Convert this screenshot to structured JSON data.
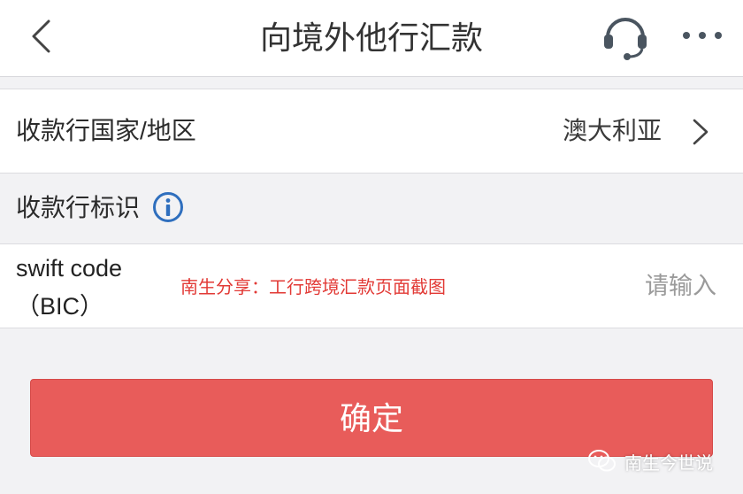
{
  "header": {
    "title": "向境外他行汇款",
    "back_icon": "chevron-left-icon",
    "support_icon": "headset-icon",
    "more_icon": "more-dots-icon"
  },
  "country_row": {
    "label": "收款行国家/地区",
    "value": "澳大利亚",
    "chevron_icon": "chevron-right-icon"
  },
  "bank_id_section": {
    "label": "收款行标识",
    "info_icon": "info-icon"
  },
  "swift_row": {
    "label_line1": "swift code",
    "label_line2": "（BIC）",
    "annotation": "南生分享：工行跨境汇款页面截图",
    "placeholder": "请输入",
    "value": ""
  },
  "confirm_button": {
    "label": "确定"
  },
  "watermark": {
    "text": "南生今世说",
    "icon": "wechat-icon"
  },
  "colors": {
    "primary_button": "#e85c5a",
    "annotation_red": "#e23a36",
    "info_blue": "#2f6fbe",
    "page_bg": "#f2f2f4"
  }
}
